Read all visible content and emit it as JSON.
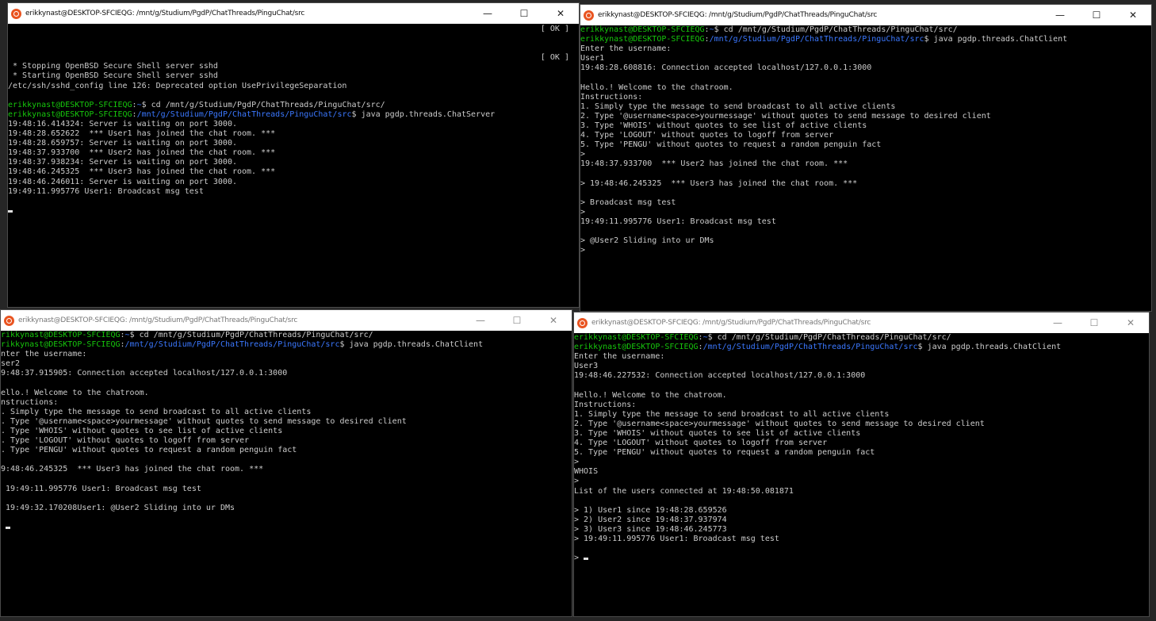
{
  "windows": [
    {
      "title": "erikkynast@DESKTOP-SFCIEQG: /mnt/g/Studium/PgdP/ChatThreads/PinguChat/src",
      "controls": [
        "—",
        "☐",
        "✕"
      ],
      "ok_labels": [
        "[ OK ]",
        "[ OK ]"
      ],
      "lines": [
        {
          "text": " * Stopping OpenBSD Secure Shell server sshd"
        },
        {
          "text": " * Starting OpenBSD Secure Shell server sshd"
        },
        {
          "text": "/etc/ssh/sshd_config line 126: Deprecated option UsePrivilegeSeparation"
        },
        {
          "text": ""
        },
        {
          "user": "erikkynast@DESKTOP-SFCIEQG",
          "path": "~",
          "cmd": "$ cd /mnt/g/Studium/PgdP/ChatThreads/PinguChat/src/"
        },
        {
          "user": "erikkynast@DESKTOP-SFCIEQG",
          "path": "/mnt/g/Studium/PgdP/ChatThreads/PinguChat/src",
          "cmd": "$ java pgdp.threads.ChatServer"
        },
        {
          "text": "19:48:16.414324: Server is waiting on port 3000."
        },
        {
          "text": "19:48:28.652622  *** User1 has joined the chat room. ***"
        },
        {
          "text": "19:48:28.659757: Server is waiting on port 3000."
        },
        {
          "text": "19:48:37.933700  *** User2 has joined the chat room. ***"
        },
        {
          "text": "19:48:37.938234: Server is waiting on port 3000."
        },
        {
          "text": "19:48:46.245325  *** User3 has joined the chat room. ***"
        },
        {
          "text": "19:48:46.246011: Server is waiting on port 3000."
        },
        {
          "text": "19:49:11.995776 User1: Broadcast msg test"
        },
        {
          "text": ""
        },
        {
          "text": "",
          "cursor": true
        }
      ]
    },
    {
      "title": "erikkynast@DESKTOP-SFCIEQG: /mnt/g/Studium/PgdP/ChatThreads/PinguChat/src",
      "controls": [
        "—",
        "☐",
        "✕"
      ],
      "lines": [
        {
          "user": "erikkynast@DESKTOP-SFCIEQG",
          "path": "~",
          "cmd": "$ cd /mnt/g/Studium/PgdP/ChatThreads/PinguChat/src/"
        },
        {
          "user": "erikkynast@DESKTOP-SFCIEQG",
          "path": "/mnt/g/Studium/PgdP/ChatThreads/PinguChat/src",
          "cmd": "$ java pgdp.threads.ChatClient"
        },
        {
          "text": "Enter the username:"
        },
        {
          "text": "User1"
        },
        {
          "text": "19:48:28.608816: Connection accepted localhost/127.0.0.1:3000"
        },
        {
          "text": ""
        },
        {
          "text": "Hello.! Welcome to the chatroom."
        },
        {
          "text": "Instructions:"
        },
        {
          "text": "1. Simply type the message to send broadcast to all active clients"
        },
        {
          "text": "2. Type '@username<space>yourmessage' without quotes to send message to desired client"
        },
        {
          "text": "3. Type 'WHOIS' without quotes to see list of active clients"
        },
        {
          "text": "4. Type 'LOGOUT' without quotes to logoff from server"
        },
        {
          "text": "5. Type 'PENGU' without quotes to request a random penguin fact"
        },
        {
          "text": ">"
        },
        {
          "text": "19:48:37.933700  *** User2 has joined the chat room. ***"
        },
        {
          "text": ""
        },
        {
          "text": "> 19:48:46.245325  *** User3 has joined the chat room. ***"
        },
        {
          "text": ""
        },
        {
          "text": "> Broadcast msg test"
        },
        {
          "text": ">"
        },
        {
          "text": "19:49:11.995776 User1: Broadcast msg test"
        },
        {
          "text": ""
        },
        {
          "text": "> @User2 Sliding into ur DMs"
        },
        {
          "text": ">"
        }
      ]
    },
    {
      "title": "erikkynast@DESKTOP-SFCIEQG: /mnt/g/Studium/PgdP/ChatThreads/PinguChat/src",
      "controls": [
        "—",
        "☐",
        "✕"
      ],
      "lines": [
        {
          "user": "rikkynast@DESKTOP-SFCIEQG",
          "path": "~",
          "cmd": "$ cd /mnt/g/Studium/PgdP/ChatThreads/PinguChat/src/"
        },
        {
          "user": "rikkynast@DESKTOP-SFCIEQG",
          "path": "/mnt/g/Studium/PgdP/ChatThreads/PinguChat/src",
          "cmd": "$ java pgdp.threads.ChatClient"
        },
        {
          "text": "nter the username:"
        },
        {
          "text": "ser2"
        },
        {
          "text": "9:48:37.915905: Connection accepted localhost/127.0.0.1:3000"
        },
        {
          "text": ""
        },
        {
          "text": "ello.! Welcome to the chatroom."
        },
        {
          "text": "nstructions:"
        },
        {
          "text": ". Simply type the message to send broadcast to all active clients"
        },
        {
          "text": ". Type '@username<space>yourmessage' without quotes to send message to desired client"
        },
        {
          "text": ". Type 'WHOIS' without quotes to see list of active clients"
        },
        {
          "text": ". Type 'LOGOUT' without quotes to logoff from server"
        },
        {
          "text": ". Type 'PENGU' without quotes to request a random penguin fact"
        },
        {
          "text": ""
        },
        {
          "text": "9:48:46.245325  *** User3 has joined the chat room. ***"
        },
        {
          "text": ""
        },
        {
          "text": " 19:49:11.995776 User1: Broadcast msg test"
        },
        {
          "text": ""
        },
        {
          "text": " 19:49:32.170208User1: @User2 Sliding into ur DMs"
        },
        {
          "text": ""
        },
        {
          "text": " ",
          "cursor": true
        }
      ]
    },
    {
      "title": "erikkynast@DESKTOP-SFCIEQG: /mnt/g/Studium/PgdP/ChatThreads/PinguChat/src",
      "controls": [
        "—",
        "☐",
        "✕"
      ],
      "lines": [
        {
          "user": "erikkynast@DESKTOP-SFCIEQG",
          "path": "~",
          "cmd": "$ cd /mnt/g/Studium/PgdP/ChatThreads/PinguChat/src/"
        },
        {
          "user": "erikkynast@DESKTOP-SFCIEQG",
          "path": "/mnt/g/Studium/PgdP/ChatThreads/PinguChat/src",
          "cmd": "$ java pgdp.threads.ChatClient"
        },
        {
          "text": "Enter the username:"
        },
        {
          "text": "User3"
        },
        {
          "text": "19:48:46.227532: Connection accepted localhost/127.0.0.1:3000"
        },
        {
          "text": ""
        },
        {
          "text": "Hello.! Welcome to the chatroom."
        },
        {
          "text": "Instructions:"
        },
        {
          "text": "1. Simply type the message to send broadcast to all active clients"
        },
        {
          "text": "2. Type '@username<space>yourmessage' without quotes to send message to desired client"
        },
        {
          "text": "3. Type 'WHOIS' without quotes to see list of active clients"
        },
        {
          "text": "4. Type 'LOGOUT' without quotes to logoff from server"
        },
        {
          "text": "5. Type 'PENGU' without quotes to request a random penguin fact"
        },
        {
          "text": ">"
        },
        {
          "text": "WHOIS"
        },
        {
          "text": ">"
        },
        {
          "text": "List of the users connected at 19:48:50.081871"
        },
        {
          "text": ""
        },
        {
          "text": "> 1) User1 since 19:48:28.659526"
        },
        {
          "text": "> 2) User2 since 19:48:37.937974"
        },
        {
          "text": "> 3) User3 since 19:48:46.245773"
        },
        {
          "text": "> 19:49:11.995776 User1: Broadcast msg test"
        },
        {
          "text": ""
        },
        {
          "text": "> ",
          "cursor": true
        }
      ]
    }
  ],
  "colors": {
    "prompt_user": "#16c60c",
    "prompt_path": "#3b78ff",
    "terminal_text": "#cccccc",
    "terminal_bg": "#000000",
    "ubuntu_icon": "#e95420"
  }
}
